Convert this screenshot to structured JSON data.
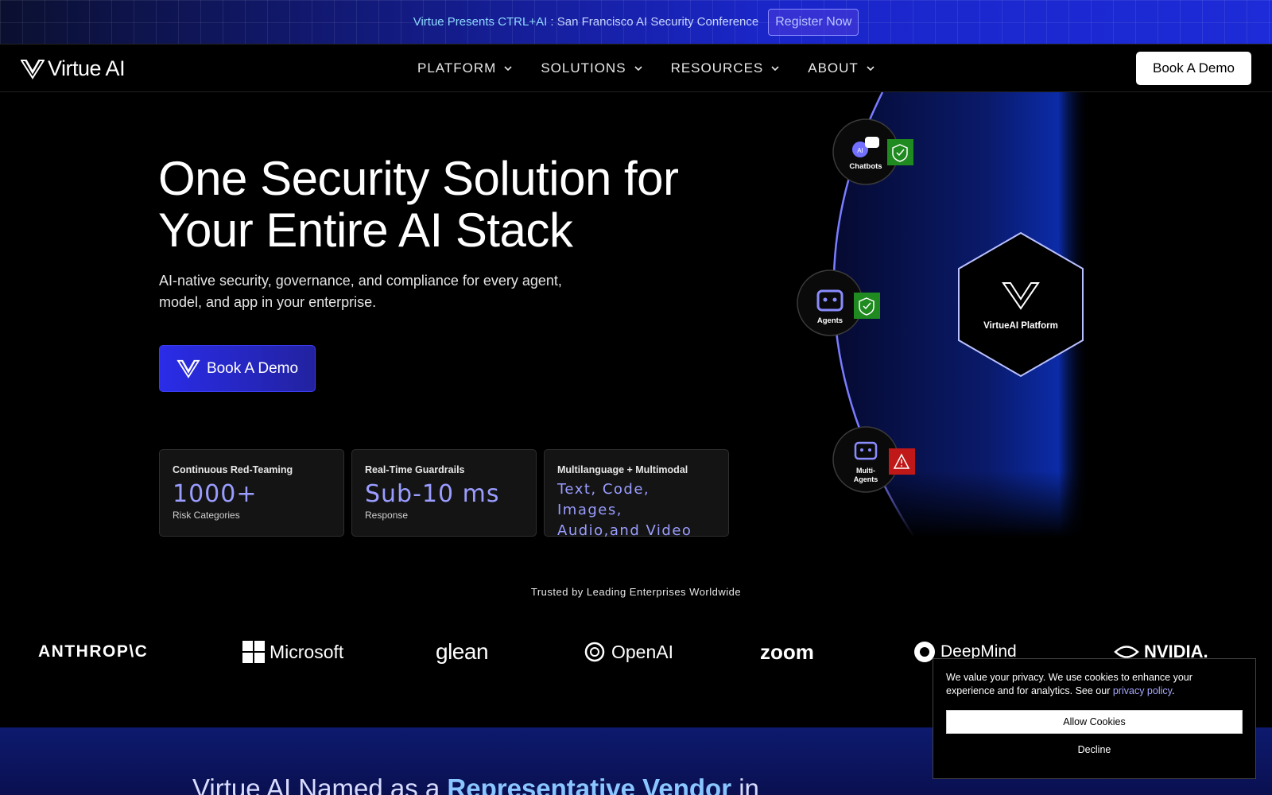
{
  "announcement": {
    "lead": "Virtue Presents CTRL+AI",
    "rest": " : San Francisco AI Security Conference",
    "register_label": "Register Now"
  },
  "nav": {
    "logo_text": "Virtue AI",
    "items": [
      {
        "label": "PLATFORM"
      },
      {
        "label": "SOLUTIONS"
      },
      {
        "label": "RESOURCES"
      },
      {
        "label": "ABOUT"
      }
    ],
    "demo_label": "Book A Demo"
  },
  "hero": {
    "title_line1": "One Security Solution for",
    "title_line2": "Your Entire AI Stack",
    "subtitle_line1": "AI-native security, governance, and compliance for every agent,",
    "subtitle_line2": "model, and app in your enterprise.",
    "demo_label": "Book A Demo"
  },
  "stats": [
    {
      "label": "Continuous Red-Teaming",
      "value": "1000+",
      "caption": "Risk Categories"
    },
    {
      "label": "Real-Time Guardrails",
      "value": "Sub-10 ms",
      "caption": "Response"
    },
    {
      "label": "Multilanguage + Multimodal",
      "value_line1": "Text, Code, Images,",
      "value_line2": "Audio,and Video"
    }
  ],
  "diagram": {
    "platform_label": "VirtueAI Platform",
    "nodes": [
      {
        "label": "Chatbots",
        "status": "secure"
      },
      {
        "label": "Agents",
        "status": "secure"
      },
      {
        "label_line1": "Multi-",
        "label_line2": "Agents",
        "status": "warning"
      }
    ],
    "colors": {
      "secure": "#1f8a1f",
      "warning": "#c01818",
      "accent": "#6b6bff"
    }
  },
  "trusted": {
    "heading": "Trusted by Leading Enterprises Worldwide",
    "brands": [
      "ANTHROP\\C",
      "Microsoft",
      "glean",
      "OpenAI",
      "zoom",
      "DeepMind",
      "NVIDIA."
    ]
  },
  "lower": {
    "title_pre": "Virtue AI Named as a ",
    "title_highlight": "Representative Vendor",
    "title_post": " in"
  },
  "cookie": {
    "text": "We value your privacy. We use cookies to enhance your experience and for analytics. See our ",
    "link_text": "privacy policy",
    "text_end": ".",
    "allow_label": "Allow Cookies",
    "decline_label": "Decline"
  }
}
